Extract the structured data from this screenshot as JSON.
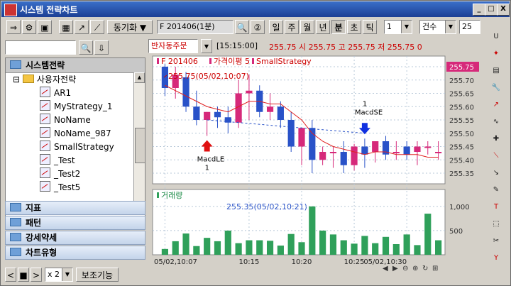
{
  "window": {
    "title": "시스템 전략차트",
    "min_label": "_",
    "max_label": "□",
    "close_label": "X"
  },
  "toolbar": {
    "sync_label": "동기화 ▼",
    "symbol_value": "F 201406(1분)",
    "period_buttons": [
      "일",
      "주",
      "월",
      "년",
      "분",
      "초",
      "틱"
    ],
    "active_period": "분",
    "interval_value": "1",
    "count_label": "건수",
    "count_value": "25"
  },
  "left": {
    "search_value": "",
    "tree_header": "시스템전략",
    "folder": "사용자전략",
    "items": [
      "AR1",
      "MyStrategy_1",
      "NoName",
      "NoName_987",
      "SmallStrategy",
      "_Test",
      "_Test2",
      "_Test5"
    ],
    "categories": [
      "지표",
      "패턴",
      "강세약세",
      "차트유형"
    ],
    "zoom_value": "x 2",
    "aux_label": "보조기능"
  },
  "quote": {
    "order_label": "반자동주문",
    "time": "[15:15:00]",
    "text": "255.75 시 255.75 고 255.75 저 255.75 0"
  },
  "chart_data": [
    {
      "type": "candlestick",
      "title_parts": [
        "F 201406",
        "가격이평 5",
        "SmallStrategy"
      ],
      "y_ticks": [
        255.35,
        255.4,
        255.45,
        255.5,
        255.55,
        255.6,
        255.65,
        255.7,
        255.75
      ],
      "ylim": [
        255.31,
        255.79
      ],
      "current_price": "255.75",
      "high_annotation": "255.75(05/02,10:07)",
      "low_annotation": "255.35(05/02,10:21)",
      "candles": [
        {
          "o": 255.75,
          "h": 255.76,
          "l": 255.64,
          "c": 255.67
        },
        {
          "o": 255.67,
          "h": 255.75,
          "l": 255.63,
          "c": 255.72
        },
        {
          "o": 255.71,
          "h": 255.73,
          "l": 255.58,
          "c": 255.6
        },
        {
          "o": 255.6,
          "h": 255.66,
          "l": 255.53,
          "c": 255.55
        },
        {
          "o": 255.55,
          "h": 255.58,
          "l": 255.49,
          "c": 255.58
        },
        {
          "o": 255.58,
          "h": 255.6,
          "l": 255.52,
          "c": 255.56
        },
        {
          "o": 255.56,
          "h": 255.6,
          "l": 255.5,
          "c": 255.54
        },
        {
          "o": 255.54,
          "h": 255.7,
          "l": 255.52,
          "c": 255.65
        },
        {
          "o": 255.65,
          "h": 255.72,
          "l": 255.55,
          "c": 255.66
        },
        {
          "o": 255.66,
          "h": 255.68,
          "l": 255.56,
          "c": 255.58
        },
        {
          "o": 255.58,
          "h": 255.65,
          "l": 255.55,
          "c": 255.6
        },
        {
          "o": 255.6,
          "h": 255.62,
          "l": 255.52,
          "c": 255.55
        },
        {
          "o": 255.55,
          "h": 255.58,
          "l": 255.43,
          "c": 255.45
        },
        {
          "o": 255.45,
          "h": 255.52,
          "l": 255.38,
          "c": 255.52
        },
        {
          "o": 255.52,
          "h": 255.55,
          "l": 255.35,
          "c": 255.4
        },
        {
          "o": 255.4,
          "h": 255.45,
          "l": 255.38,
          "c": 255.43
        },
        {
          "o": 255.43,
          "h": 255.45,
          "l": 255.37,
          "c": 255.43
        },
        {
          "o": 255.43,
          "h": 255.47,
          "l": 255.35,
          "c": 255.38
        },
        {
          "o": 255.38,
          "h": 255.46,
          "l": 255.36,
          "c": 255.45
        },
        {
          "o": 255.45,
          "h": 255.48,
          "l": 255.37,
          "c": 255.42
        },
        {
          "o": 255.43,
          "h": 255.47,
          "l": 255.39,
          "c": 255.47
        },
        {
          "o": 255.47,
          "h": 255.49,
          "l": 255.4,
          "c": 255.42
        },
        {
          "o": 255.43,
          "h": 255.47,
          "l": 255.4,
          "c": 255.43
        },
        {
          "o": 255.45,
          "h": 255.47,
          "l": 255.4,
          "c": 255.42
        },
        {
          "o": 255.43,
          "h": 255.47,
          "l": 255.38,
          "c": 255.45
        },
        {
          "o": 255.45,
          "h": 255.47,
          "l": 255.42,
          "c": 255.45
        },
        {
          "o": 255.43,
          "h": 255.47,
          "l": 255.4,
          "c": 255.43
        }
      ],
      "ma5": [
        255.68,
        255.66,
        255.64,
        255.62,
        255.6,
        255.59,
        255.58,
        255.6,
        255.62,
        255.62,
        255.61,
        255.61,
        255.58,
        255.55,
        255.5,
        255.47,
        255.45,
        255.44,
        255.43,
        255.42,
        255.43,
        255.43,
        255.42,
        255.42,
        255.42,
        255.41,
        255.41
      ],
      "signals": [
        {
          "index": 4,
          "type": "buy",
          "name": "MacdLE",
          "qty": "1"
        },
        {
          "index": 19,
          "type": "sell",
          "name": "MacdSE",
          "qty": "1"
        }
      ]
    },
    {
      "type": "bar",
      "title": "거래량",
      "y_ticks": [
        500,
        "1,000"
      ],
      "ylim": [
        0,
        1350
      ],
      "values": [
        120,
        280,
        440,
        180,
        350,
        280,
        500,
        240,
        300,
        300,
        290,
        190,
        430,
        260,
        1000,
        500,
        420,
        300,
        230,
        390,
        240,
        370,
        220,
        420,
        200,
        850,
        300
      ],
      "x_labels": [
        "05/02,10:07",
        "10:15",
        "10:20",
        "10:25",
        "05/02,10:30"
      ],
      "x_label_index": [
        0,
        8,
        13,
        18,
        23
      ]
    }
  ],
  "colors": {
    "up": "#d6297a",
    "down": "#2952c8",
    "ma": "#e02020",
    "volume": "#2fa05a",
    "grid": "#b8c8d8"
  }
}
